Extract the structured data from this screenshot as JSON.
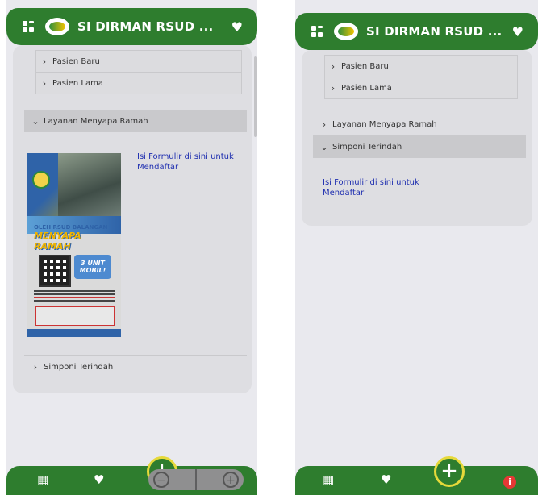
{
  "app": {
    "title": "SI DIRMAN RSUD ...",
    "accent_color": "#2e7d2e",
    "fab_ring_color": "#e6d93a"
  },
  "left_screen": {
    "submenu": [
      "Pasien Baru",
      "Pasien Lama"
    ],
    "open_section": "Layanan Menyapa Ramah",
    "link_text": "Isi Formulir di sini untuk Mendaftar",
    "collapsed_section": "Simponi Terindah",
    "poster": {
      "heading": "OLEH RSUD BALANGAN",
      "title": "MENYAPA RAMAH",
      "unit_label": "3 UNIT MOBIL!"
    }
  },
  "right_screen": {
    "submenu": [
      "Pasien Baru",
      "Pasien Lama"
    ],
    "section_closed": "Layanan Menyapa Ramah",
    "section_open": "Simponi Terindah",
    "link_text": "Isi Formulir di sini untuk Mendaftar"
  },
  "nav": {
    "icons": [
      "calendar-icon",
      "heartbeat-icon",
      "add-icon",
      "info-icon"
    ],
    "fab_symbol": "+",
    "zoom_out": "−",
    "zoom_in": "+"
  }
}
